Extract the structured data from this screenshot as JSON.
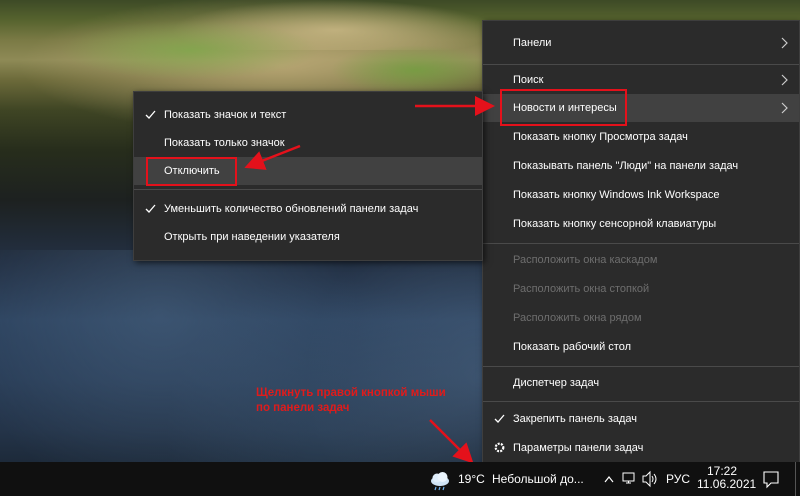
{
  "context_menu": {
    "items": [
      {
        "label": "Панели",
        "submenu": true,
        "enabled": true
      },
      {
        "label": "Поиск",
        "submenu": true,
        "enabled": true
      },
      {
        "label": "Новости и интересы",
        "submenu": true,
        "enabled": true,
        "highlighted": true
      },
      {
        "label": "Показать кнопку Просмотра задач",
        "enabled": true
      },
      {
        "label": "Показывать панель \"Люди\" на панели задач",
        "enabled": true
      },
      {
        "label": "Показать кнопку Windows Ink Workspace",
        "enabled": true
      },
      {
        "label": "Показать кнопку сенсорной клавиатуры",
        "enabled": true
      },
      {
        "label": "Расположить окна каскадом",
        "enabled": false
      },
      {
        "label": "Расположить окна стопкой",
        "enabled": false
      },
      {
        "label": "Расположить окна рядом",
        "enabled": false
      },
      {
        "label": "Показать рабочий стол",
        "enabled": true
      },
      {
        "label": "Диспетчер задач",
        "enabled": true
      },
      {
        "label": "Закрепить панель задач",
        "enabled": true,
        "checked": true
      },
      {
        "label": "Параметры панели задач",
        "enabled": true,
        "icon": "gear-icon"
      }
    ]
  },
  "submenu": {
    "items": [
      {
        "label": "Показать значок и текст",
        "checked": true
      },
      {
        "label": "Показать только значок",
        "checked": false
      },
      {
        "label": "Отключить",
        "checked": false,
        "highlighted": true
      },
      {
        "label": "Уменьшить количество обновлений панели задач",
        "checked": true
      },
      {
        "label": "Открыть при наведении указателя",
        "checked": false
      }
    ]
  },
  "annotation": {
    "line1": "Щелкнуть правой кнопкой мыши",
    "line2": "по панели задач"
  },
  "taskbar": {
    "weather_icon": "cloud-icon",
    "temperature": "19°C",
    "weather_text": "Небольшой до...",
    "language": "РУС",
    "time": "17:22",
    "date": "11.06.2021"
  },
  "colors": {
    "menu_bg": "#2b2b2b",
    "highlight": "#414141",
    "annotation_red": "#e4111b",
    "taskbar_bg": "#101010"
  }
}
